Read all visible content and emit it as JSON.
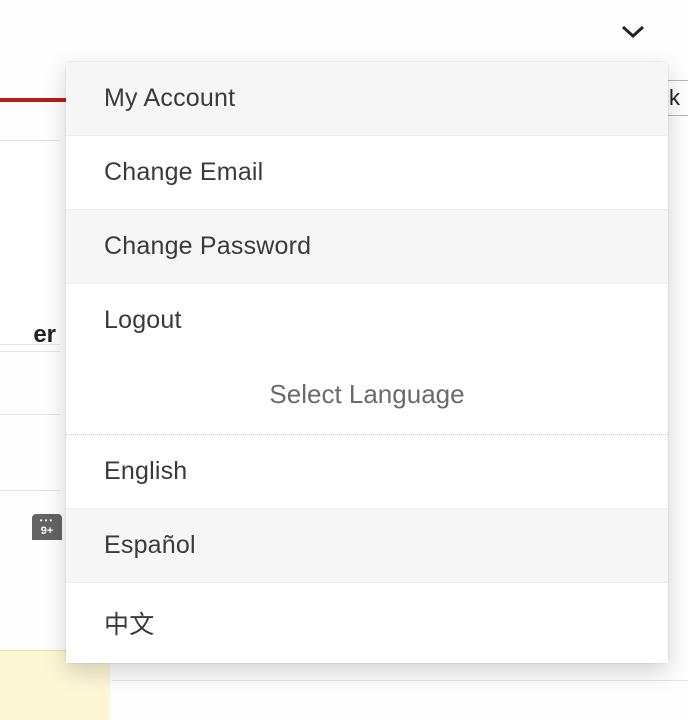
{
  "trigger": {
    "icon": "chevron-down-icon"
  },
  "tooltip": {
    "text": "Click"
  },
  "menu": {
    "my_account": "My Account",
    "change_email": "Change Email",
    "change_password": "Change Password",
    "logout": "Logout",
    "select_language_header": "Select Language",
    "lang_english": "English",
    "lang_spanish": "Español",
    "lang_chinese": "中文"
  },
  "background": {
    "partial_label": "er",
    "badge_text": "9+"
  }
}
